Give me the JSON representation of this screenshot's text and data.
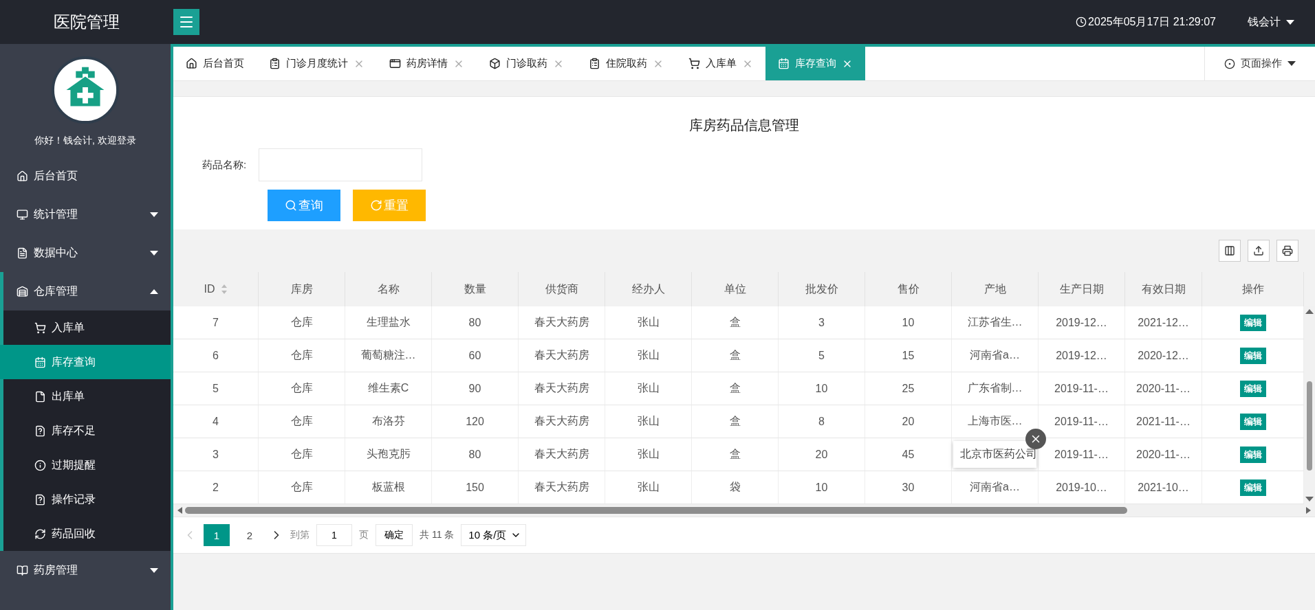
{
  "header": {
    "title": "医院管理",
    "datetime": "2025年05月17日 21:29:07",
    "user": "钱会计"
  },
  "sidebar": {
    "greeting": "你好！钱会计, 欢迎登录",
    "menu": [
      {
        "label": "后台首页",
        "selected": false
      },
      {
        "label": "统计管理",
        "selected": false,
        "expanded": false
      },
      {
        "label": "数据中心",
        "selected": false,
        "expanded": false
      },
      {
        "label": "仓库管理",
        "selected": false,
        "expanded": true,
        "children": [
          {
            "label": "入库单",
            "selected": false
          },
          {
            "label": "库存查询",
            "selected": true
          },
          {
            "label": "出库单",
            "selected": false
          },
          {
            "label": "库存不足",
            "selected": false
          },
          {
            "label": "过期提醒",
            "selected": false
          },
          {
            "label": "操作记录",
            "selected": false
          },
          {
            "label": "药品回收",
            "selected": false
          }
        ]
      },
      {
        "label": "药房管理",
        "selected": false,
        "expanded": false
      }
    ]
  },
  "tabs": [
    {
      "label": "后台首页",
      "selected": false,
      "closable": false
    },
    {
      "label": "门诊月度统计",
      "selected": false,
      "closable": true
    },
    {
      "label": "药房详情",
      "selected": false,
      "closable": true
    },
    {
      "label": "门诊取药",
      "selected": false,
      "closable": true
    },
    {
      "label": "住院取药",
      "selected": false,
      "closable": true
    },
    {
      "label": "入库单",
      "selected": false,
      "closable": true
    },
    {
      "label": "库存查询",
      "selected": true,
      "closable": true
    }
  ],
  "page_actions": "页面操作",
  "form": {
    "title": "库房药品信息管理",
    "field_label": "药品名称:",
    "buttons": [
      {
        "label": "查询",
        "kind": "primary"
      },
      {
        "label": "重置",
        "kind": "warning"
      }
    ]
  },
  "table": {
    "columns": [
      {
        "label": "ID",
        "sortable": true
      },
      {
        "label": "库房",
        "sortable": false
      },
      {
        "label": "名称",
        "sortable": false
      },
      {
        "label": "数量",
        "sortable": false
      },
      {
        "label": "供货商",
        "sortable": false
      },
      {
        "label": "经办人",
        "sortable": false
      },
      {
        "label": "单位",
        "sortable": false
      },
      {
        "label": "批发价",
        "sortable": false
      },
      {
        "label": "售价",
        "sortable": false
      },
      {
        "label": "产地",
        "sortable": false
      },
      {
        "label": "生产日期",
        "sortable": false
      },
      {
        "label": "有效日期",
        "sortable": false
      },
      {
        "label": "操作",
        "sortable": false
      }
    ],
    "rows": [
      {
        "cells": [
          "7",
          "仓库",
          "生理盐水",
          "80",
          "春天大药房",
          "张山",
          "盒",
          "3",
          "10",
          "江苏省生…",
          "2019-12…",
          "2021-12…"
        ],
        "action": "编辑"
      },
      {
        "cells": [
          "6",
          "仓库",
          "葡萄糖注…",
          "60",
          "春天大药房",
          "张山",
          "盒",
          "5",
          "15",
          "河南省a…",
          "2019-12…",
          "2020-12…"
        ],
        "action": "编辑"
      },
      {
        "cells": [
          "5",
          "仓库",
          "维生素C",
          "90",
          "春天大药房",
          "张山",
          "盒",
          "10",
          "25",
          "广东省制…",
          "2019-11-…",
          "2020-11-…"
        ],
        "action": "编辑"
      },
      {
        "cells": [
          "4",
          "仓库",
          "布洛芬",
          "120",
          "春天大药房",
          "张山",
          "盒",
          "8",
          "20",
          "上海市医…",
          "2019-11-…",
          "2021-11-…"
        ],
        "action": "编辑"
      },
      {
        "cells": [
          "3",
          "仓库",
          "头孢克肟",
          "80",
          "春天大药房",
          "张山",
          "盒",
          "20",
          "45",
          {
            "text": "北京市医药公司",
            "expanded": true
          },
          "2019-11-…",
          "2020-11-…"
        ],
        "action": "编辑"
      },
      {
        "cells": [
          "2",
          "仓库",
          "板蓝根",
          "150",
          "春天大药房",
          "张山",
          "袋",
          "10",
          "30",
          "河南省a…",
          "2019-10…",
          "2021-10…"
        ],
        "action": "编辑"
      }
    ]
  },
  "pagination": {
    "prev_disabled": true,
    "pages": [
      {
        "label": "1",
        "selected": true
      },
      {
        "label": "2",
        "selected": false
      }
    ],
    "goto_label": "到第",
    "goto_value": "1",
    "page_suffix": "页",
    "confirm": "确定",
    "total": "共 11 条",
    "page_size": "10 条/页"
  }
}
